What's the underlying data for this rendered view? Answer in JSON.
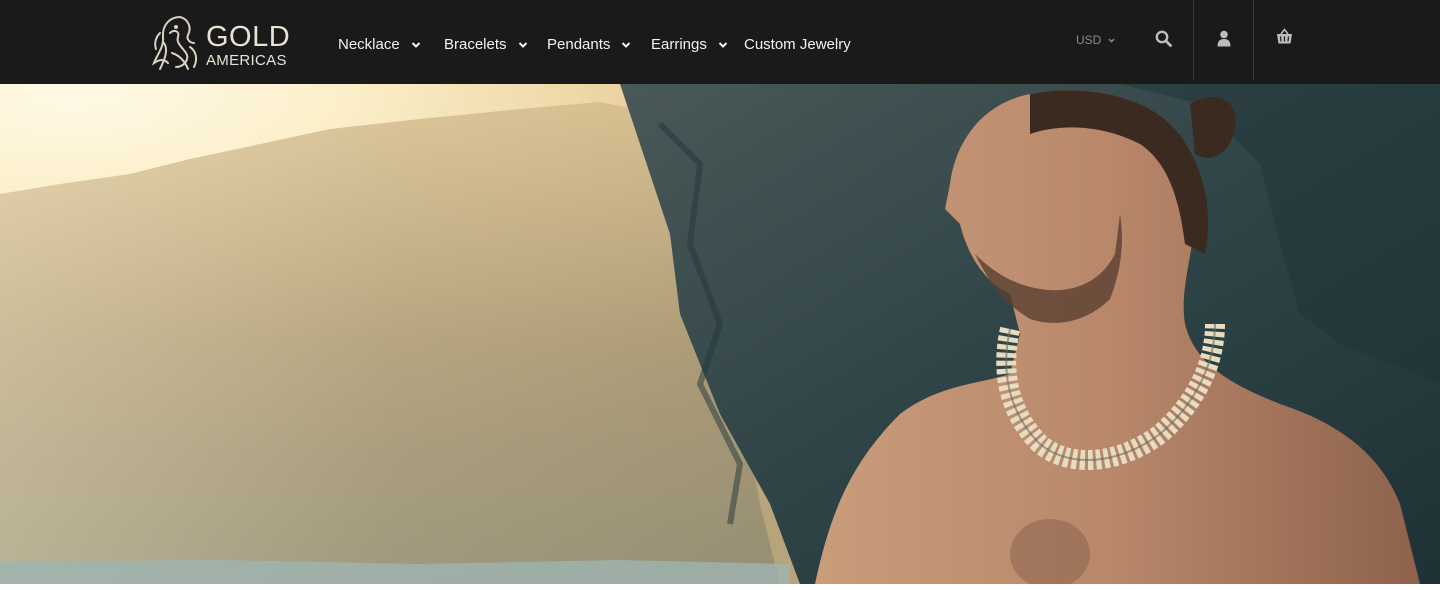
{
  "brand": {
    "logo_word1": "GOLD",
    "logo_word2": "AMERICAS"
  },
  "nav": {
    "items": [
      {
        "label": "Necklace",
        "has_dropdown": true
      },
      {
        "label": "Bracelets",
        "has_dropdown": true
      },
      {
        "label": "Pendants",
        "has_dropdown": true
      },
      {
        "label": "Earrings",
        "has_dropdown": true
      },
      {
        "label": "Custom Jewelry",
        "has_dropdown": false
      }
    ]
  },
  "header_tools": {
    "currency": "USD",
    "icons": [
      "search-icon",
      "user-icon",
      "basket-icon"
    ]
  },
  "colors": {
    "header_bg": "#1a1a1a",
    "nav_text": "#f2f2f2",
    "muted_text": "#8a8a8a"
  },
  "hero": {
    "image": "man-with-necklace-by-sea-cliff"
  }
}
